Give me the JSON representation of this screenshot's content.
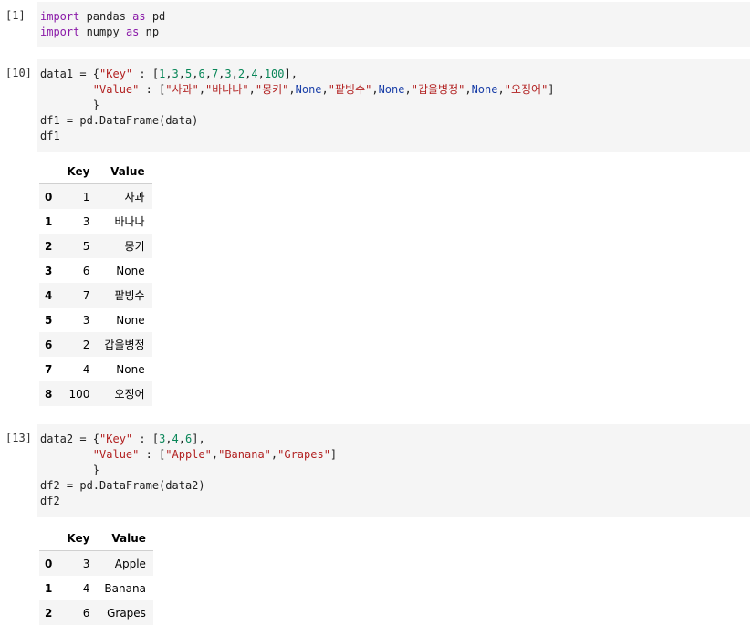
{
  "cells": [
    {
      "prompt": "[1]",
      "code_lines": [
        [
          {
            "t": "import",
            "c": "kw"
          },
          {
            "t": " pandas "
          },
          {
            "t": "as",
            "c": "kw"
          },
          {
            "t": " pd"
          }
        ],
        [
          {
            "t": "import",
            "c": "kw"
          },
          {
            "t": " numpy "
          },
          {
            "t": "as",
            "c": "kw"
          },
          {
            "t": " np"
          }
        ]
      ]
    },
    {
      "prompt": "[10]",
      "code_lines": [
        [
          {
            "t": "data1 = {"
          },
          {
            "t": "\"Key\"",
            "c": "str"
          },
          {
            "t": " : ["
          },
          {
            "t": "1",
            "c": "num"
          },
          {
            "t": ","
          },
          {
            "t": "3",
            "c": "num"
          },
          {
            "t": ","
          },
          {
            "t": "5",
            "c": "num"
          },
          {
            "t": ","
          },
          {
            "t": "6",
            "c": "num"
          },
          {
            "t": ","
          },
          {
            "t": "7",
            "c": "num"
          },
          {
            "t": ","
          },
          {
            "t": "3",
            "c": "num"
          },
          {
            "t": ","
          },
          {
            "t": "2",
            "c": "num"
          },
          {
            "t": ","
          },
          {
            "t": "4",
            "c": "num"
          },
          {
            "t": ","
          },
          {
            "t": "100",
            "c": "num"
          },
          {
            "t": "],"
          }
        ],
        [
          {
            "t": "        "
          },
          {
            "t": "\"Value\"",
            "c": "str"
          },
          {
            "t": " : ["
          },
          {
            "t": "\"사과\"",
            "c": "str"
          },
          {
            "t": ","
          },
          {
            "t": "\"바나나\"",
            "c": "str"
          },
          {
            "t": ","
          },
          {
            "t": "\"몽키\"",
            "c": "str"
          },
          {
            "t": ","
          },
          {
            "t": "None",
            "c": "none"
          },
          {
            "t": ","
          },
          {
            "t": "\"팥빙수\"",
            "c": "str"
          },
          {
            "t": ","
          },
          {
            "t": "None",
            "c": "none"
          },
          {
            "t": ","
          },
          {
            "t": "\"갑을병정\"",
            "c": "str"
          },
          {
            "t": ","
          },
          {
            "t": "None",
            "c": "none"
          },
          {
            "t": ","
          },
          {
            "t": "\"오징어\"",
            "c": "str"
          },
          {
            "t": "]"
          }
        ],
        [
          {
            "t": "        }"
          }
        ],
        [
          {
            "t": "df1 = pd.DataFrame(data)"
          }
        ],
        [
          {
            "t": "df1"
          }
        ]
      ],
      "table": {
        "columns": [
          "",
          "Key",
          "Value"
        ],
        "rows": [
          [
            "0",
            "1",
            "사과"
          ],
          [
            "1",
            "3",
            "바나나"
          ],
          [
            "2",
            "5",
            "몽키"
          ],
          [
            "3",
            "6",
            "None"
          ],
          [
            "4",
            "7",
            "팥빙수"
          ],
          [
            "5",
            "3",
            "None"
          ],
          [
            "6",
            "2",
            "갑을병정"
          ],
          [
            "7",
            "4",
            "None"
          ],
          [
            "8",
            "100",
            "오징어"
          ]
        ]
      }
    },
    {
      "prompt": "[13]",
      "code_lines": [
        [
          {
            "t": "data2 = {"
          },
          {
            "t": "\"Key\"",
            "c": "str"
          },
          {
            "t": " : ["
          },
          {
            "t": "3",
            "c": "num"
          },
          {
            "t": ","
          },
          {
            "t": "4",
            "c": "num"
          },
          {
            "t": ","
          },
          {
            "t": "6",
            "c": "num"
          },
          {
            "t": "],"
          }
        ],
        [
          {
            "t": "        "
          },
          {
            "t": "\"Value\"",
            "c": "str"
          },
          {
            "t": " : ["
          },
          {
            "t": "\"Apple\"",
            "c": "str"
          },
          {
            "t": ","
          },
          {
            "t": "\"Banana\"",
            "c": "str"
          },
          {
            "t": ","
          },
          {
            "t": "\"Grapes\"",
            "c": "str"
          },
          {
            "t": "]"
          }
        ],
        [
          {
            "t": "        }"
          }
        ],
        [
          {
            "t": "df2 = pd.DataFrame(data2)"
          }
        ],
        [
          {
            "t": "df2"
          }
        ]
      ],
      "table": {
        "columns": [
          "",
          "Key",
          "Value"
        ],
        "rows": [
          [
            "0",
            "3",
            "Apple"
          ],
          [
            "1",
            "4",
            "Banana"
          ],
          [
            "2",
            "6",
            "Grapes"
          ]
        ]
      }
    }
  ]
}
